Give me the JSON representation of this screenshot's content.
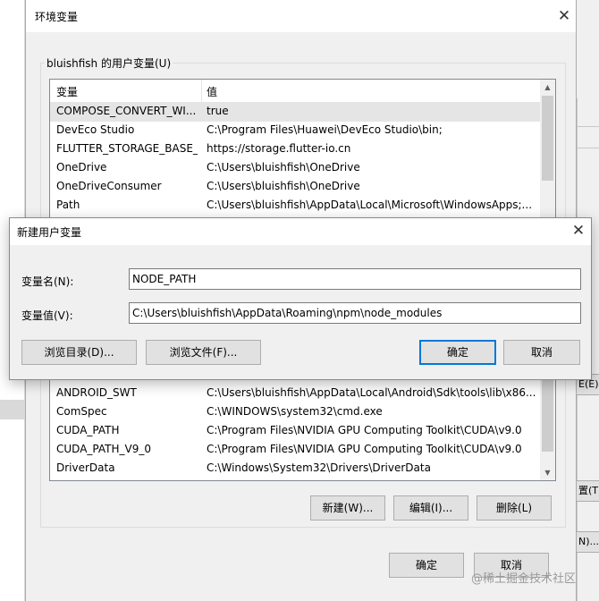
{
  "env_window": {
    "title": "环境变量",
    "user_vars_group_label": "bluishfish 的用户变量(U)",
    "columns": {
      "name": "变量",
      "value": "值"
    },
    "user_vars": [
      {
        "name": "COMPOSE_CONVERT_WI...",
        "value": "true",
        "selected": true
      },
      {
        "name": "DevEco Studio",
        "value": "C:\\Program Files\\Huawei\\DevEco Studio\\bin;"
      },
      {
        "name": "FLUTTER_STORAGE_BASE_...",
        "value": "https://storage.flutter-io.cn"
      },
      {
        "name": "OneDrive",
        "value": "C:\\Users\\bluishfish\\OneDrive"
      },
      {
        "name": "OneDriveConsumer",
        "value": "C:\\Users\\bluishfish\\OneDrive"
      },
      {
        "name": "Path",
        "value": "C:\\Users\\bluishfish\\AppData\\Local\\Microsoft\\WindowsApps;..."
      }
    ],
    "system_vars": [
      {
        "name": "ANDROID_SWT",
        "value": "C:\\Users\\bluishfish\\AppData\\Local\\Android\\Sdk\\tools\\lib\\x86..."
      },
      {
        "name": "ComSpec",
        "value": "C:\\WINDOWS\\system32\\cmd.exe"
      },
      {
        "name": "CUDA_PATH",
        "value": "C:\\Program Files\\NVIDIA GPU Computing Toolkit\\CUDA\\v9.0"
      },
      {
        "name": "CUDA_PATH_V9_0",
        "value": "C:\\Program Files\\NVIDIA GPU Computing Toolkit\\CUDA\\v9.0"
      },
      {
        "name": "DriverData",
        "value": "C:\\Windows\\System32\\Drivers\\DriverData"
      }
    ],
    "buttons": {
      "new": "新建(W)...",
      "edit": "编辑(I)...",
      "delete": "删除(L)",
      "ok": "确定",
      "cancel": "取消"
    }
  },
  "dialog": {
    "title": "新建用户变量",
    "name_label": "变量名(N):",
    "name_value": "NODE_PATH",
    "value_label": "变量值(V):",
    "value_value": "C:\\Users\\bluishfish\\AppData\\Roaming\\npm\\node_modules",
    "buttons": {
      "browse_dir": "浏览目录(D)...",
      "browse_file": "浏览文件(F)...",
      "ok": "确定",
      "cancel": "取消"
    }
  },
  "background": {
    "right_btn_1": "É(E)...",
    "right_btn_2": "置(T)...",
    "right_btn_3": "N)..."
  },
  "icons": {
    "close": "close-icon",
    "scroll_up": "scroll-up-icon",
    "scroll_down": "scroll-down-icon"
  },
  "watermark": "@稀土掘金技术社区"
}
